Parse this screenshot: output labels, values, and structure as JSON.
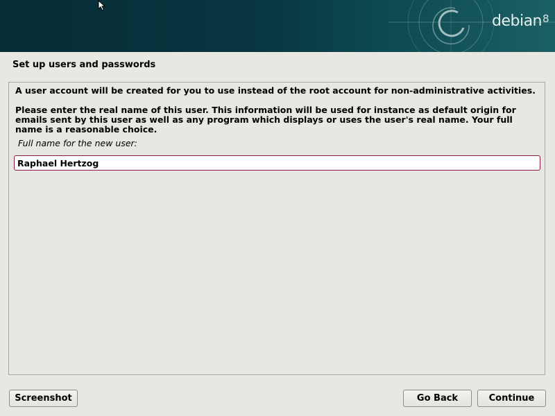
{
  "header": {
    "brand": "debian",
    "brand_version": "8",
    "logo_icon": "debian-swirl-icon"
  },
  "page": {
    "title": "Set up users and passwords",
    "intro": "A user account will be created for you to use instead of the root account for non-administrative activities.",
    "description_lines": [
      "Please enter the real name of this user. This information will be used for instance as default origin for",
      "emails sent by this user as well as any program which displays or uses the user's real name. Your full",
      "name is a reasonable choice."
    ],
    "field_label": "Full name for the new user:",
    "field_value": "Raphael Hertzog"
  },
  "buttons": {
    "screenshot": "Screenshot",
    "go_back": "Go Back",
    "continue": "Continue"
  },
  "colors": {
    "banner": "#083540",
    "input_border": "#8c1b3d",
    "background": "#e8e7e1"
  }
}
